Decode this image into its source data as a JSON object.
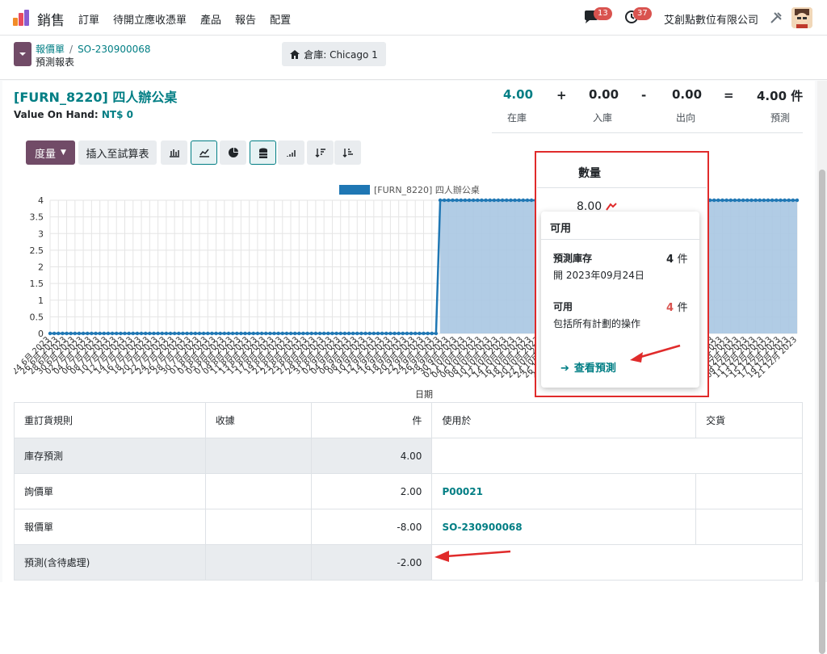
{
  "topbar": {
    "app_name": "銷售",
    "menu": [
      "訂單",
      "待開立應收憑單",
      "產品",
      "報告",
      "配置"
    ],
    "chat_count": "13",
    "activity_count": "37",
    "company": "艾創點數位有限公司"
  },
  "breadcrumb": {
    "parent": "報價單",
    "current": "SO-230900068",
    "page": "預測報表"
  },
  "warehouse_button": "倉庫: Chicago 1",
  "product": {
    "title": "[FURN_8220] 四人辦公桌",
    "value_on_hand_label": "Value On Hand:",
    "value_on_hand": "NT$ 0"
  },
  "summary": {
    "on_hand": "4.00",
    "on_hand_label": "在庫",
    "plus": "+",
    "incoming": "0.00",
    "incoming_label": "入庫",
    "minus": "-",
    "outgoing": "0.00",
    "outgoing_label": "出向",
    "equals": "=",
    "forecast": "4.00 件",
    "forecast_label": "預測"
  },
  "toolbar": {
    "measure": "度量",
    "insert": "插入至試算表"
  },
  "chart_data": {
    "type": "area",
    "legend": [
      "[FURN_8220] 四人辦公桌"
    ],
    "xlabel": "日期",
    "ylim": [
      0,
      4
    ],
    "yticks": [
      "0",
      "0.5",
      "1",
      "1.5",
      "2",
      "2.5",
      "3",
      "3.5",
      "4"
    ],
    "x_tick_labels": [
      "24 6月 2023",
      "26 6月 2023",
      "28 6月 2023",
      "30 6月 2023",
      "02 7月 2023",
      "04 7月 2023",
      "06 7月 2023",
      "08 7月 2023",
      "10 7月 2023",
      "12 7月 2023",
      "14 7月 2023",
      "16 7月 2023",
      "18 7月 2023",
      "20 7月 2023",
      "22 7月 2023",
      "24 7月 2023",
      "26 7月 2023",
      "28 7月 2023",
      "30 7月 2023",
      "01 8月 2023",
      "03 8月 2023",
      "05 8月 2023",
      "07 8月 2023",
      "09 8月 2023",
      "11 8月 2023",
      "13 8月 2023",
      "15 8月 2023",
      "17 8月 2023",
      "19 8月 2023",
      "21 8月 2023",
      "23 8月 2023",
      "25 8月 2023",
      "27 8月 2023",
      "29 8月 2023",
      "31 8月 2023",
      "02 9月 2023",
      "04 9月 2023",
      "06 9月 2023",
      "08 9月 2023",
      "10 9月 2023",
      "12 9月 2023",
      "14 9月 2023",
      "16 9月 2023",
      "18 9月 2023",
      "20 9月 2023",
      "22 9月 2023",
      "24 9月 2023",
      "26 9月 2023",
      "28 9月 2023",
      "30 9月 2023",
      "02 10月 2023",
      "04 10月 2023",
      "06 10月 2023",
      "08 10月 2023",
      "10 10月 2023",
      "12 10月 2023",
      "14 10月 2023",
      "16 10月 2023",
      "18 10月 2023",
      "20 10月 2023",
      "22 10月 2023",
      "24 10月 2023",
      "26 10月 2023",
      "28 10月 2023",
      "30 10月 2023",
      "01 11月 2023",
      "03 11月 2023",
      "05 11月 2023",
      "07 11月 2023",
      "09 11月 2023",
      "11 11月 2023",
      "13 11月 2023",
      "15 11月 2023",
      "17 11月 2023",
      "19 11月 2023",
      "21 11月 2023",
      "23 11月 2023",
      "25 11月 2023",
      "27 11月 2023",
      "29 11月 2023",
      "01 12月 2023",
      "03 12月 2023",
      "05 12月 2023",
      "07 12月 2023",
      "09 12月 2023",
      "11 12月 2023",
      "13 12月 2023",
      "15 12月 2023",
      "17 12月 2023",
      "19 12月 2023",
      "21 12月 2023"
    ],
    "series": [
      {
        "name": "[FURN_8220] 四人辦公桌",
        "step_date": "26 9月 2023",
        "before": 0,
        "after": 4
      }
    ],
    "colors": {
      "line": "#1f77b4",
      "fill": "#a9c6e2"
    }
  },
  "popover": {
    "header": "數量",
    "value": "8.00",
    "card_title": "可用",
    "forecast_stock_label": "預測庫存",
    "forecast_stock_value": "4",
    "forecast_stock_unit": "件",
    "forecast_stock_date": "開 2023年09月24日",
    "available_label": "可用",
    "available_value": "4",
    "available_unit": "件",
    "available_note": "包括所有計劃的操作",
    "view_link": "查看預測"
  },
  "table": {
    "headers": [
      "重訂貨規則",
      "收據",
      "件",
      "使用於",
      "交貨"
    ],
    "rows": [
      {
        "label": "庫存預測",
        "qty": "4.00",
        "used_in": ""
      },
      {
        "label": "詢價單",
        "qty": "2.00",
        "used_in": "P00021"
      },
      {
        "label": "報價單",
        "qty": "-8.00",
        "used_in": "SO-230900068"
      },
      {
        "label": "預測(含待處理)",
        "qty": "-2.00",
        "used_in": ""
      }
    ]
  }
}
